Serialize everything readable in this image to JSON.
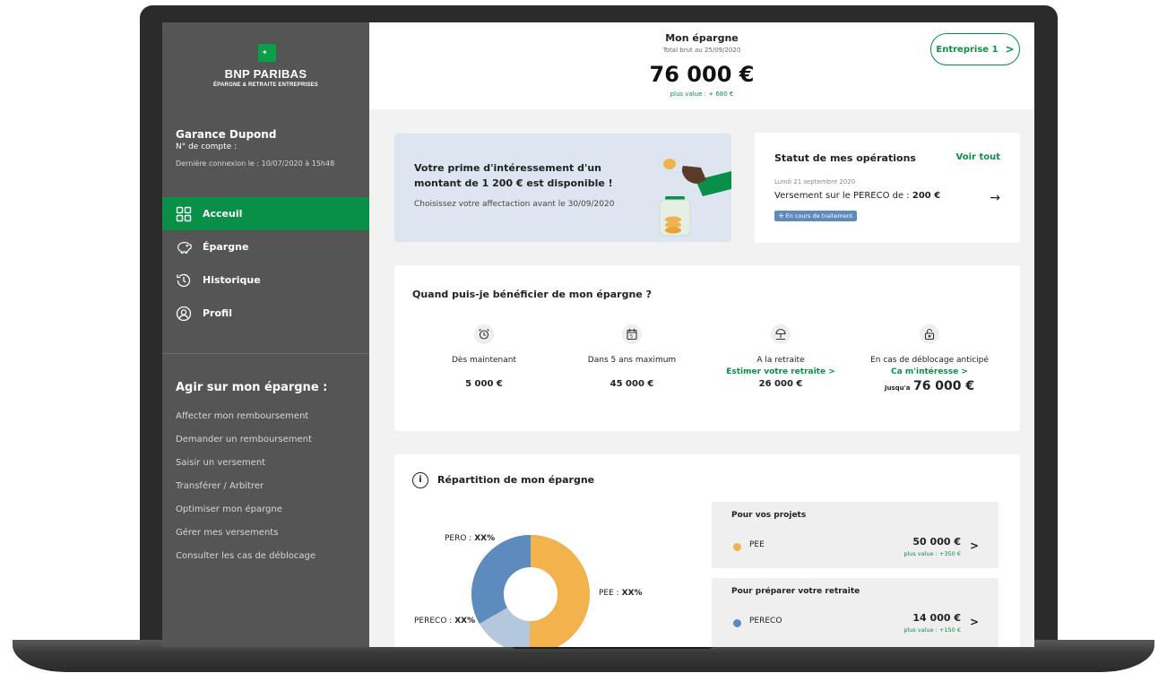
{
  "brand": {
    "name": "BNP PARIBAS",
    "subtitle": "ÉPARGNE & RETRAITE ENTREPRISES"
  },
  "user": {
    "name": "Garance Dupond",
    "account_label": "N° de compte :",
    "last_login": "Dernière connexion le : 10/07/2020 à 15h48"
  },
  "nav": [
    {
      "label": "Acceuil",
      "icon": "grid-icon",
      "active": true
    },
    {
      "label": "Épargne",
      "icon": "piggy-bank-icon",
      "active": false
    },
    {
      "label": "Historique",
      "icon": "history-icon",
      "active": false
    },
    {
      "label": "Profil",
      "icon": "user-icon",
      "active": false
    }
  ],
  "agir": {
    "title": "Agir sur mon épargne :",
    "items": [
      "Affecter mon remboursement",
      "Demander un remboursement",
      "Saisir un versement",
      "Transférer / Arbitrer",
      "Optimiser mon épargne",
      "Gérer mes versements",
      "Consulter les cas de déblocage"
    ]
  },
  "header": {
    "title": "Mon épargne",
    "subtitle": "Total brut au 25/09/2020",
    "total": "76 000 €",
    "plus_value": "plus value : + 680 €",
    "entreprise_button": "Entreprise 1"
  },
  "promo": {
    "title": "Votre prime d'intéressement d'un montant de 1 200 € est disponible !",
    "subtitle": "Choisissez votre affectaction avant le 30/09/2020"
  },
  "status": {
    "title": "Statut de mes opérations",
    "link": "Voir tout",
    "date": "Lundi 21 septembre 2020",
    "operation_prefix": "Versement sur le PERECO de :",
    "operation_amount": "200 €",
    "badge": "En cours de traitement"
  },
  "quand": {
    "title": "Quand puis-je bénéficier de mon épargne ?",
    "columns": [
      {
        "icon": "alarm-clock-icon",
        "label": "Dès maintenant",
        "link": "",
        "amount": "5 000 €"
      },
      {
        "icon": "calendar-icon",
        "label": "Dans 5 ans maximum",
        "link": "",
        "amount": "45 000 €"
      },
      {
        "icon": "beach-umbrella-icon",
        "label": "A la retraite",
        "link": "Estimer votre retraite  >",
        "amount": "26 000 €"
      },
      {
        "icon": "unlock-icon",
        "label": "En cas de déblocage anticipé",
        "link": "Ca m'intéresse  >",
        "amount_prefix": "Jusqu'a",
        "amount": "76 000 €"
      }
    ]
  },
  "repartition": {
    "title": "Répartition de mon épargne",
    "labels": {
      "pero": "PERO :",
      "pee": "PEE :",
      "pereco": "PERECO :",
      "pct": "XX%"
    },
    "colors": {
      "pee": "#f2b24c",
      "pereco": "#5e8bbd",
      "pero": "#b3c8dd"
    },
    "groups": [
      {
        "title": "Pour vos projets",
        "name": "PEE",
        "amount": "50 000 €",
        "plus_value": "plus value : +350 €",
        "color": "#f2b24c"
      },
      {
        "title": "Pour préparer votre retraite",
        "name": "PERECO",
        "amount": "14 000 €",
        "plus_value": "plus value : +150 €",
        "color": "#5e8bbd"
      }
    ]
  }
}
